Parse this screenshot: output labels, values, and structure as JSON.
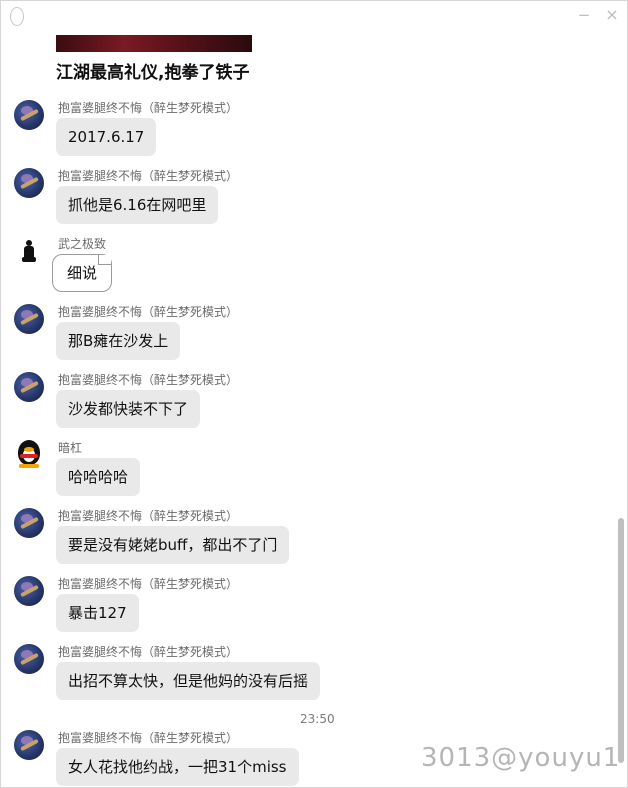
{
  "media": {
    "caption": "江湖最高礼仪,抱拳了铁子"
  },
  "messages": [
    {
      "sender": "抱富婆腿终不悔（醉生梦死模式）",
      "text": "2017.6.17",
      "avatar": "sword-avatar"
    },
    {
      "sender": "抱富婆腿终不悔（醉生梦死模式）",
      "text": "抓他是6.16在网吧里",
      "avatar": "sword-avatar"
    },
    {
      "sender": "武之极致",
      "text": "细说",
      "avatar": "chess-piece-avatar"
    },
    {
      "sender": "抱富婆腿终不悔（醉生梦死模式）",
      "text": "那B瘫在沙发上",
      "avatar": "sword-avatar"
    },
    {
      "sender": "抱富婆腿终不悔（醉生梦死模式）",
      "text": "沙发都快装不下了",
      "avatar": "sword-avatar"
    },
    {
      "sender": "暗杠",
      "text": "哈哈哈哈",
      "avatar": "penguin-avatar"
    },
    {
      "sender": "抱富婆腿终不悔（醉生梦死模式）",
      "text": "要是没有姥姥buff，都出不了门",
      "avatar": "sword-avatar"
    },
    {
      "sender": "抱富婆腿终不悔（醉生梦死模式）",
      "text": "暴击127",
      "avatar": "sword-avatar"
    },
    {
      "sender": "抱富婆腿终不悔（醉生梦死模式）",
      "text": "出招不算太快，但是他妈的没有后摇",
      "avatar": "sword-avatar"
    },
    {
      "sender": "抱富婆腿终不悔（醉生梦死模式）",
      "text": "女人花找他约战，一把31个miss",
      "avatar": "sword-avatar"
    }
  ],
  "timestamp": "23:50",
  "watermark": "3013@youyu1",
  "window_controls": {
    "minimize": "−",
    "close": "×"
  }
}
